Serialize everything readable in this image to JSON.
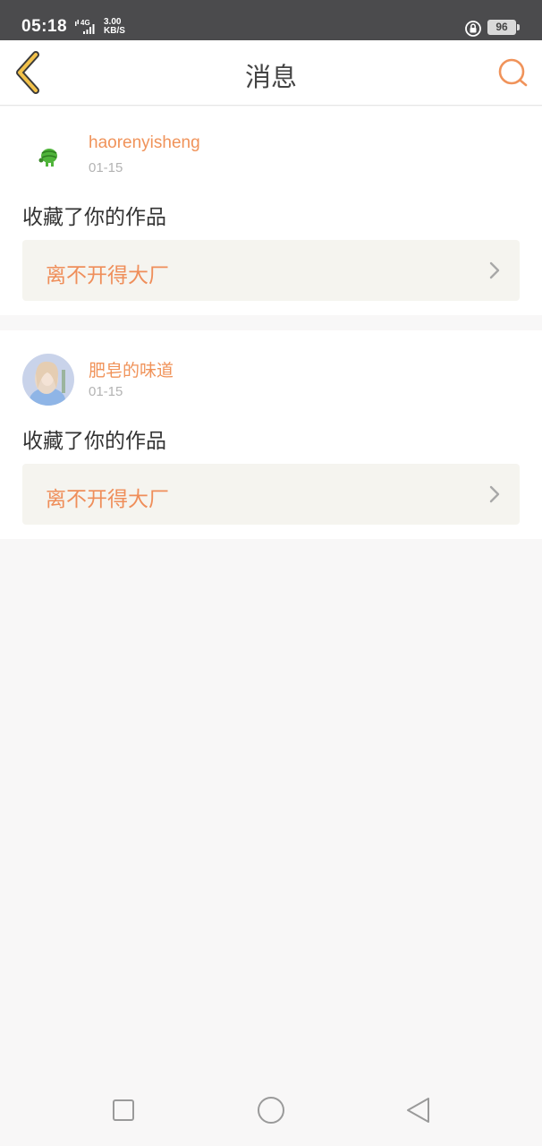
{
  "status_bar": {
    "time": "05:18",
    "network": "4G",
    "speed_value": "3.00",
    "speed_unit": "KB/S",
    "battery": "96"
  },
  "header": {
    "title": "消息",
    "back_icon": "chevron-left-icon",
    "search_icon": "search-icon"
  },
  "messages": [
    {
      "username": "haorenyisheng",
      "date": "01-15",
      "action": "收藏了你的作品",
      "work_title": "离不开得大厂",
      "avatar": "green-character-avatar"
    },
    {
      "username": "肥皂的味道",
      "date": "01-15",
      "action": "收藏了你的作品",
      "work_title": "离不开得大厂",
      "avatar": "girl-photo-avatar"
    }
  ],
  "colors": {
    "accent": "#f0935a",
    "back_icon_fill": "#f3c24b",
    "status_bar_bg": "#4b4b4d",
    "work_box_bg": "#f5f4ef",
    "page_bg": "#f8f7f7"
  }
}
